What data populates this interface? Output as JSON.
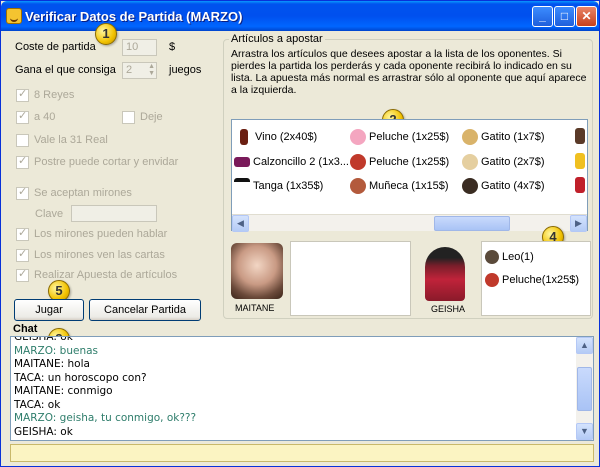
{
  "window": {
    "title": "Verificar Datos de Partida (MARZO)"
  },
  "badges": [
    "1",
    "2",
    "3",
    "4",
    "5"
  ],
  "settings": {
    "coste_label": "Coste de partida",
    "coste_value": "10",
    "coste_unit": "$",
    "gana_label": "Gana el que consiga",
    "gana_value": "2",
    "gana_unit": "juegos",
    "reyes_label": "8 Reyes",
    "a40_label": "a 40",
    "deje_label": "Deje",
    "vale31_label": "Vale la 31 Real",
    "postre_label": "Postre puede cortar y envidar",
    "mirones_label": "Se aceptan mirones",
    "clave_label": "Clave",
    "clave_value": "",
    "hablar_label": "Los mirones pueden hablar",
    "ven_label": "Los mirones ven las cartas",
    "apuesta_label": "Realizar Apuesta de artículos"
  },
  "buttons": {
    "jugar": "Jugar",
    "cancelar": "Cancelar Partida"
  },
  "articulos": {
    "group_label": "Artículos a apostar",
    "description": "Arrastra los artículos que desees apostar a la lista de los oponentes. Si pierdes la partida los perderás y cada oponente recibirá lo indicado en su lista. La apuesta más normal es arrastrar sólo al oponente que aquí aparece a la izquierda.",
    "items": [
      [
        "Vino (2x40$)",
        "Peluche (1x25$)",
        "Gatito (1x7$)"
      ],
      [
        "Calzoncillo 2 (1x3...",
        "Peluche (1x25$)",
        "Gatito (2x7$)"
      ],
      [
        "Tanga (1x35$)",
        "Muñeca (1x15$)",
        "Gatito (4x7$)"
      ]
    ]
  },
  "opponents": {
    "left_name": "MAITANE",
    "right_name": "GEISHA",
    "bet_items": [
      "Leo(1)",
      "Peluche(1x25$)"
    ]
  },
  "chat": {
    "label": "Chat",
    "lines": [
      {
        "text": "GEISHA: ok",
        "color": "#000000"
      },
      {
        "text": "MARZO: buenas",
        "color": "#2e7d6b"
      },
      {
        "text": "MAITANE: hola",
        "color": "#000000"
      },
      {
        "text": "TACA: un horoscopo con?",
        "color": "#000000"
      },
      {
        "text": "MAITANE: conmigo",
        "color": "#000000"
      },
      {
        "text": "TACA: ok",
        "color": "#000000"
      },
      {
        "text": "MARZO: geisha, tu conmigo, ok???",
        "color": "#2e7d6b"
      },
      {
        "text": "GEISHA: ok",
        "color": "#000000"
      }
    ]
  }
}
